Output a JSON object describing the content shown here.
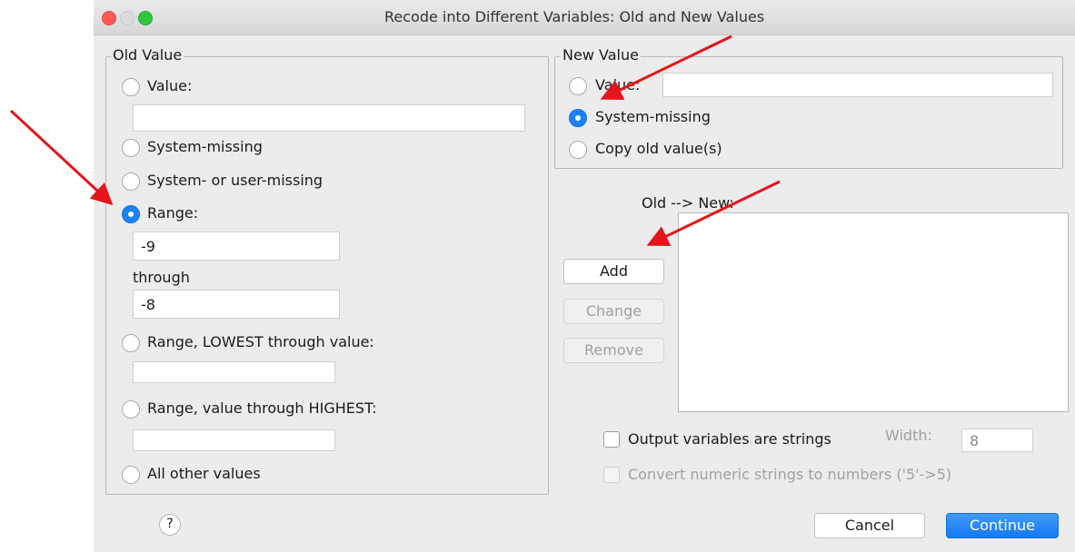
{
  "window": {
    "title": "Recode into Different Variables: Old and New Values"
  },
  "old_value": {
    "legend": "Old Value",
    "value_label": "Value:",
    "value_input": "",
    "system_missing_label": "System-missing",
    "sys_user_missing_label": "System- or user-missing",
    "range_label": "Range:",
    "range_from": "-9",
    "through_label": "through",
    "range_to": "-8",
    "lowest_label": "Range, LOWEST through value:",
    "lowest_input": "",
    "highest_label": "Range, value through HIGHEST:",
    "highest_input": "",
    "all_other_label": "All other values",
    "selected": "Range:"
  },
  "new_value": {
    "legend": "New Value",
    "value_label": "Value:",
    "value_input": "",
    "system_missing_label": "System-missing",
    "copy_label": "Copy old value(s)",
    "selected": "System-missing"
  },
  "mapping": {
    "label": "Old --> New:",
    "items": []
  },
  "buttons": {
    "add": "Add",
    "change": "Change",
    "remove": "Remove",
    "cancel": "Cancel",
    "continue": "Continue",
    "help": "?"
  },
  "options": {
    "output_strings_label": "Output variables are strings",
    "width_label": "Width:",
    "width_value": "8",
    "convert_label": "Convert numeric strings to numbers ('5'->5)"
  },
  "colors": {
    "accent": "#1a82fb",
    "arrow": "#e3161b"
  }
}
